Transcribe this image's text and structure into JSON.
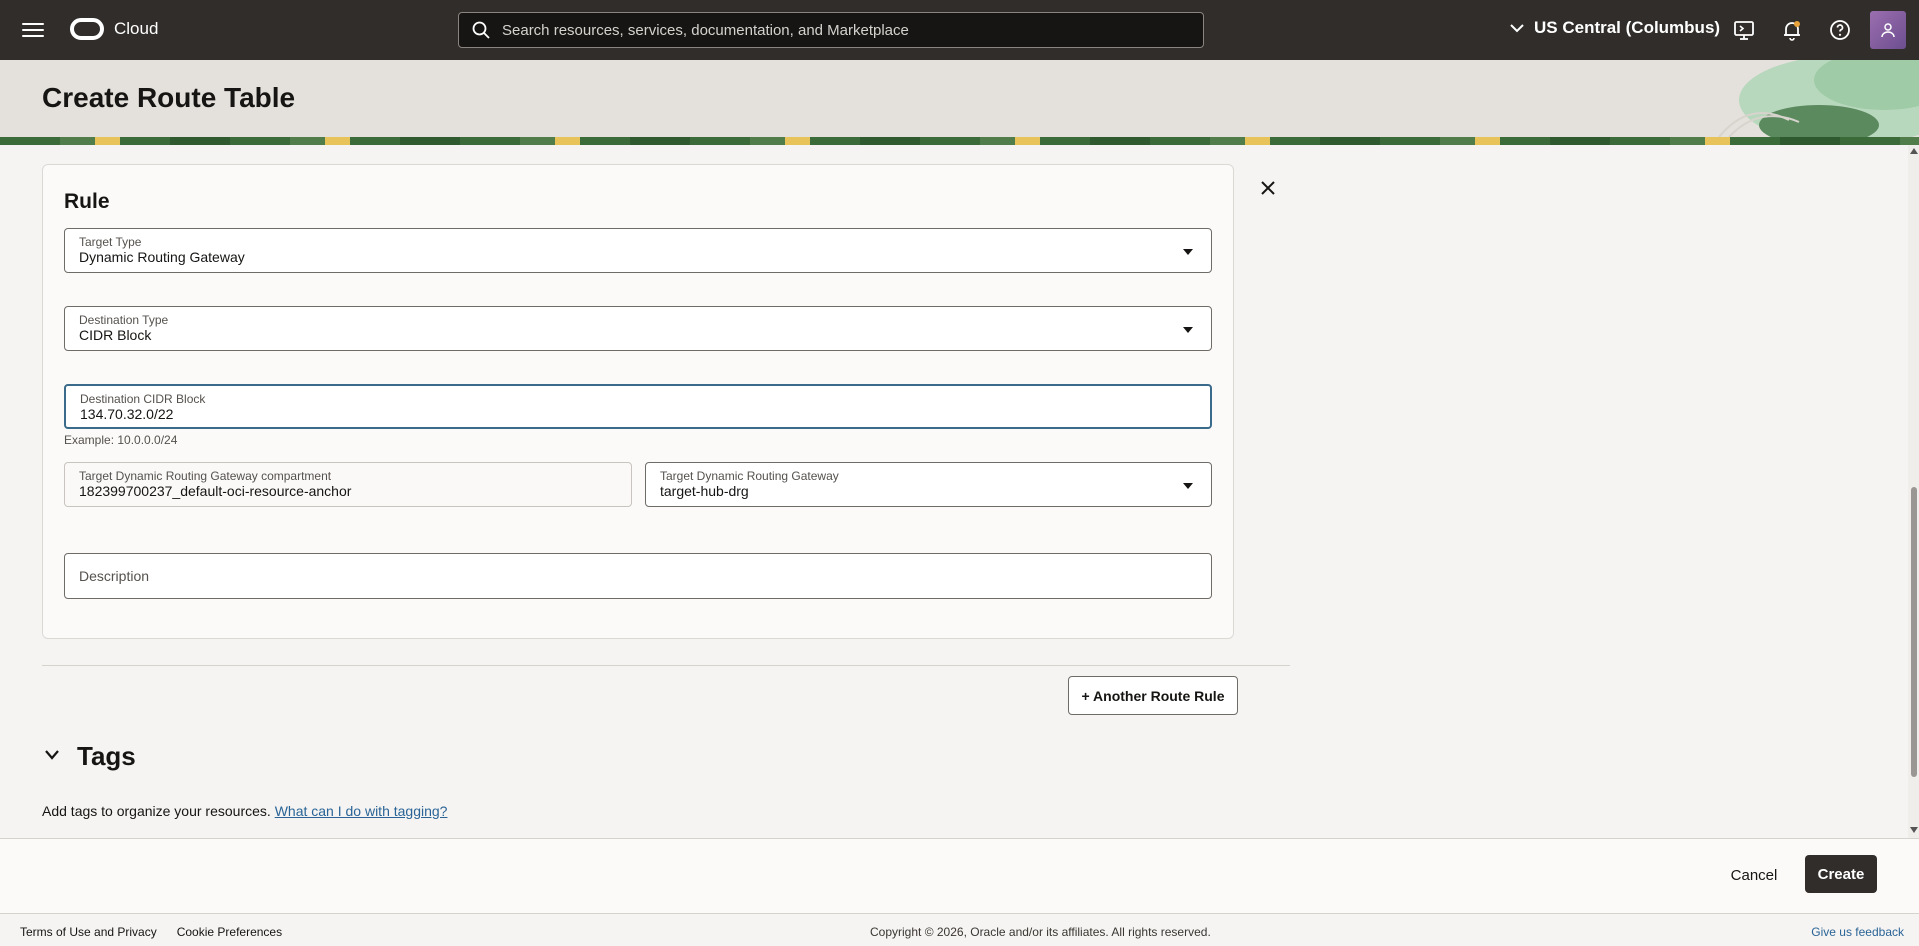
{
  "topbar": {
    "brand": "Cloud",
    "search_placeholder": "Search resources, services, documentation, and Marketplace",
    "region": "US Central (Columbus)"
  },
  "page": {
    "title": "Create Route Table"
  },
  "rule": {
    "heading": "Rule",
    "target_type": {
      "label": "Target Type",
      "value": "Dynamic Routing Gateway"
    },
    "destination_type": {
      "label": "Destination Type",
      "value": "CIDR Block"
    },
    "destination_cidr": {
      "label": "Destination CIDR Block",
      "value": "134.70.32.0/22",
      "help": "Example: 10.0.0.0/24"
    },
    "drg_compartment": {
      "label": "Target Dynamic Routing Gateway compartment",
      "value": "182399700237_default-oci-resource-anchor"
    },
    "drg": {
      "label": "Target Dynamic Routing Gateway",
      "value": "target-hub-drg"
    },
    "description": {
      "placeholder": "Description"
    }
  },
  "actions": {
    "another_rule": "+ Another Route Rule",
    "cancel": "Cancel",
    "create": "Create"
  },
  "tags": {
    "title": "Tags",
    "description": "Add tags to organize your resources.",
    "link": "What can I do with tagging?"
  },
  "footer": {
    "terms": "Terms of Use and Privacy",
    "cookies": "Cookie Preferences",
    "copyright": "Copyright © 2026, Oracle and/or its affiliates. All rights reserved.",
    "feedback": "Give us feedback"
  }
}
